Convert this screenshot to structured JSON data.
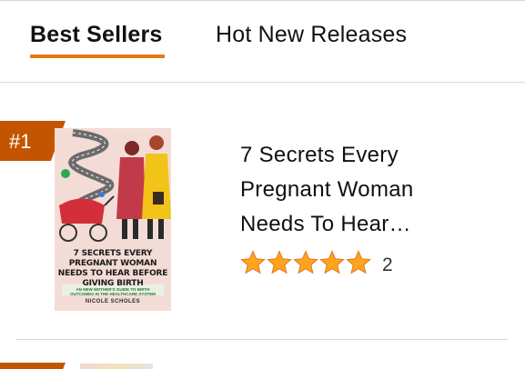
{
  "tabs": [
    {
      "label": "Best Sellers",
      "active": true
    },
    {
      "label": "Hot New Releases",
      "active": false
    }
  ],
  "accent_color": "#e47911",
  "badge_color": "#c45500",
  "star_color": "#ffa41c",
  "item": {
    "rank": "#1",
    "title_lines": [
      "7 Secrets Every",
      "Pregnant Woman",
      "Needs To Hear…"
    ],
    "rating": 5,
    "review_count": "2",
    "cover": {
      "title": "7 SECRETS EVERY PREGNANT WOMAN NEEDS TO HEAR BEFORE GIVING BIRTH",
      "subtitle": "AN NEW MOTHER'S GUIDE TO BIRTH OUTCOMES IN THE HEALTHCARE SYSTEM",
      "author": "NICOLE SCHOLES"
    }
  }
}
